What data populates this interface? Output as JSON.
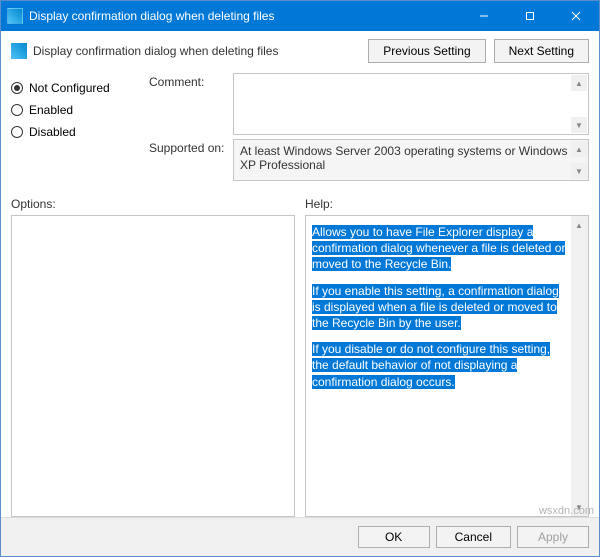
{
  "window": {
    "title": "Display confirmation dialog when deleting files"
  },
  "header": {
    "title": "Display confirmation dialog when deleting files",
    "prev_button": "Previous Setting",
    "next_button": "Next Setting"
  },
  "state": {
    "options": [
      "Not Configured",
      "Enabled",
      "Disabled"
    ],
    "not_configured": "Not Configured",
    "enabled": "Enabled",
    "disabled": "Disabled"
  },
  "fields": {
    "comment_label": "Comment:",
    "comment_value": "",
    "supported_label": "Supported on:",
    "supported_value": "At least Windows Server 2003 operating systems or Windows XP Professional"
  },
  "panels": {
    "options_label": "Options:",
    "help_label": "Help:"
  },
  "help": {
    "p1": "Allows you to have File Explorer display a confirmation dialog whenever a file is deleted or moved to the Recycle Bin.",
    "p2": "If you enable this setting, a confirmation dialog is displayed when a file is deleted or moved to the Recycle Bin by the user.",
    "p3": "If you disable or do not configure this setting, the default behavior of not displaying a confirmation dialog occurs."
  },
  "buttons": {
    "ok": "OK",
    "cancel": "Cancel",
    "apply": "Apply"
  },
  "watermark": "wsxdn.com"
}
